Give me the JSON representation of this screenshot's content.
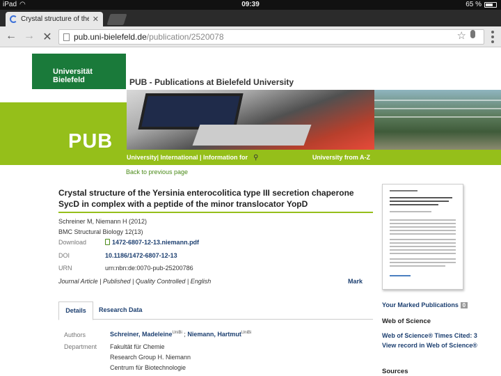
{
  "status_bar": {
    "device": "iPad",
    "time": "09:39",
    "battery": "65 %"
  },
  "browser": {
    "tab_title": "Crystal structure of the Yer",
    "url_host": "pub.uni-bielefeld.de",
    "url_path": "/publication/2520078"
  },
  "header": {
    "university": "Universität Bielefeld",
    "site_title": "PUB - Publications at Bielefeld University",
    "pub_label": "PUB",
    "nav_text": "University| International | Information for",
    "nav_az": "University from A-Z",
    "back_link": "Back to previous page"
  },
  "article": {
    "title": "Crystal structure of the Yersinia enterocolitica type III secretion chaperone SycD in complex with a peptide of the minor translocator YopD",
    "authors_year": "Schreiner M, Niemann H (2012)",
    "journal": "BMC Structural Biology 12(13)",
    "download_label": "Download",
    "download_file": "1472-6807-12-13.niemann.pdf",
    "doi_label": "DOI",
    "doi_value": "10.1186/1472-6807-12-13",
    "urn_label": "URN",
    "urn_value": "urn:nbn:de:0070-pub-25200786",
    "type_line": "Journal Article | Published | Quality Controlled | English",
    "mark_label": "Mark"
  },
  "tabs": {
    "details": "Details",
    "research": "Research Data"
  },
  "details": {
    "authors_label": "Authors",
    "author1": "Schreiner, Madeleine",
    "author1_sup": "UniBi",
    "sep": " ; ",
    "author2": "Niemann, Hartmut",
    "author2_sup": "UniBi",
    "department_label": "Department",
    "dept1": "Fakultät für Chemie",
    "dept2": "Research Group H. Niemann",
    "dept3": "Centrum für Biotechnologie"
  },
  "sidebar": {
    "marked_label": "Your Marked Publications",
    "marked_count": "0",
    "wos_heading": "Web of Science",
    "wos_cited": "Web of Science® Times Cited: 3",
    "wos_view": "View record in Web of Science®",
    "sources_heading": "Sources"
  }
}
